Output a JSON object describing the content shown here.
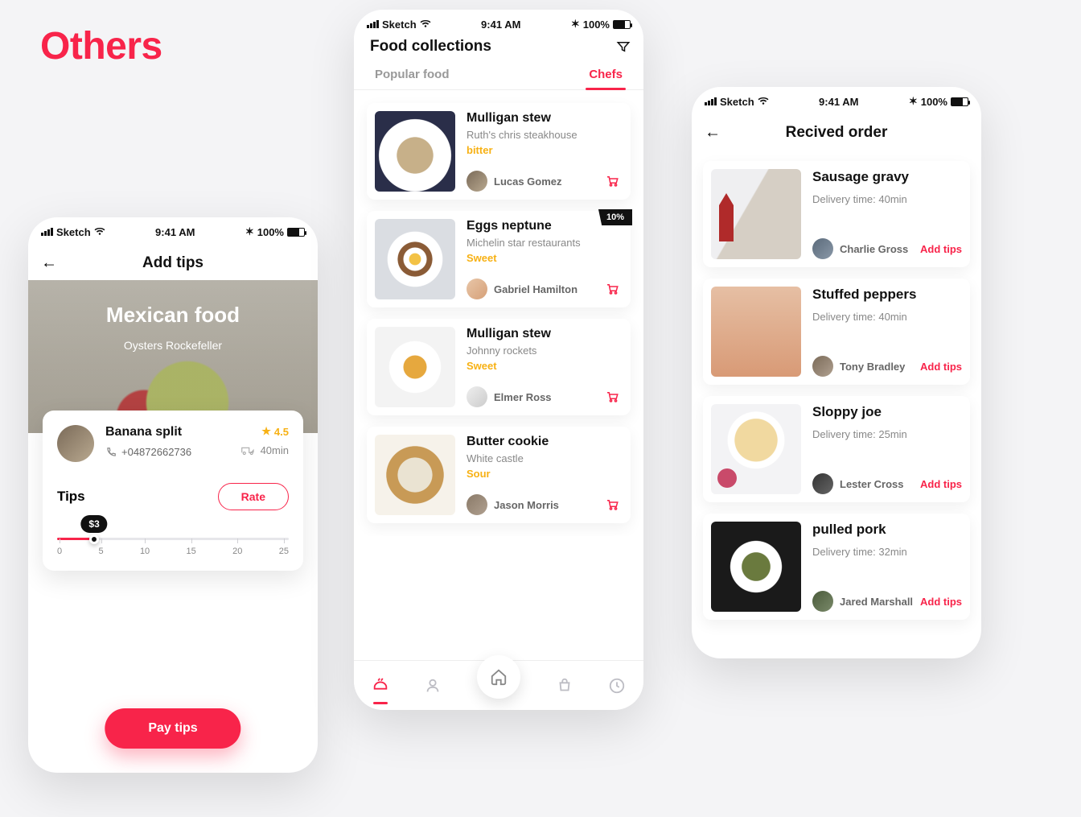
{
  "section_title": "Others",
  "status": {
    "carrier": "Sketch",
    "time": "9:41 AM",
    "battery": "100%"
  },
  "screenA": {
    "nav_title": "Add tips",
    "hero_title": "Mexican food",
    "hero_sub": "Oysters Rockefeller",
    "driver_name": "Banana split",
    "driver_phone": "+04872662736",
    "rating": "4.5",
    "eta": "40min",
    "tips_label": "Tips",
    "rate_label": "Rate",
    "tip_value": "$3",
    "ticks": [
      "0",
      "5",
      "10",
      "15",
      "20",
      "25"
    ],
    "pay_label": "Pay tips"
  },
  "screenB": {
    "nav_title": "Food collections",
    "tabs": {
      "popular": "Popular food",
      "chefs": "Chefs"
    },
    "items": [
      {
        "title": "Mulligan stew",
        "sub": "Ruth's chris steakhouse",
        "tag": "bitter",
        "chef": "Lucas Gomez",
        "badge": ""
      },
      {
        "title": "Eggs neptune",
        "sub": "Michelin star restaurants",
        "tag": "Sweet",
        "chef": "Gabriel Hamilton",
        "badge": "10%"
      },
      {
        "title": "Mulligan stew",
        "sub": "Johnny rockets",
        "tag": "Sweet",
        "chef": "Elmer Ross",
        "badge": ""
      },
      {
        "title": "Butter cookie",
        "sub": "White castle",
        "tag": "Sour",
        "chef": "Jason Morris",
        "badge": ""
      }
    ]
  },
  "screenC": {
    "nav_title": "Recived order",
    "delivery_prefix": "Delivery time: ",
    "add_tips_label": "Add tips",
    "items": [
      {
        "title": "Sausage gravy",
        "time": "40min",
        "chef": "Charlie Gross"
      },
      {
        "title": "Stuffed peppers",
        "time": "40min",
        "chef": "Tony Bradley"
      },
      {
        "title": "Sloppy joe",
        "time": "25min",
        "chef": "Lester Cross"
      },
      {
        "title": "pulled pork",
        "time": "32min",
        "chef": "Jared Marshall"
      }
    ]
  }
}
